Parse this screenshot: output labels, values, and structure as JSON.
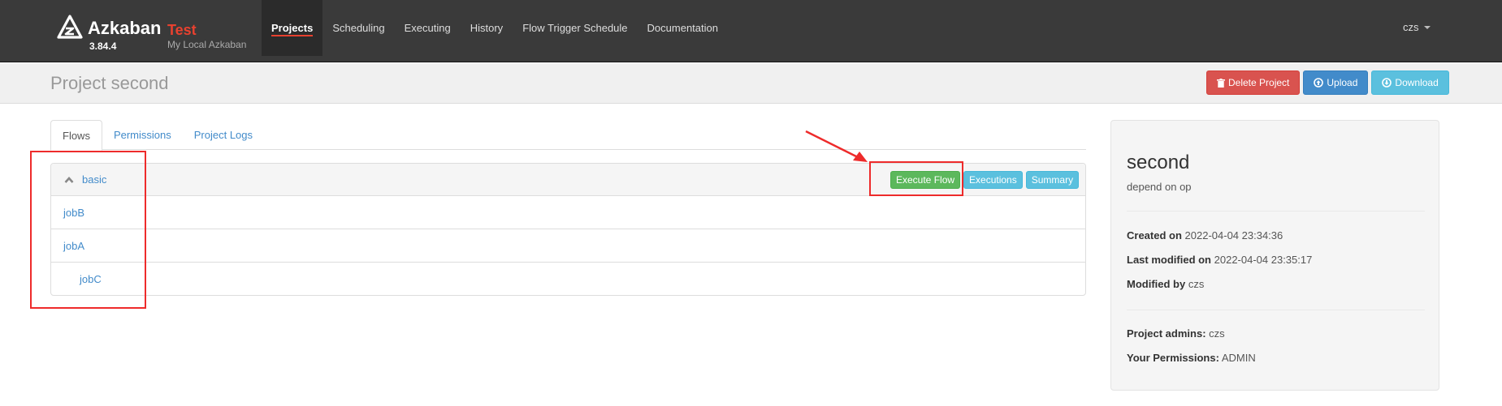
{
  "brand": {
    "name": "Azkaban",
    "env": "Test",
    "version": "3.84.4",
    "subtitle": "My Local Azkaban"
  },
  "nav": {
    "items": [
      {
        "label": "Projects",
        "active": true
      },
      {
        "label": "Scheduling"
      },
      {
        "label": "Executing"
      },
      {
        "label": "History"
      },
      {
        "label": "Flow Trigger Schedule"
      },
      {
        "label": "Documentation"
      }
    ],
    "user": "czs"
  },
  "header": {
    "title": "Project second",
    "buttons": {
      "delete": "Delete Project",
      "upload": "Upload",
      "download": "Download"
    }
  },
  "tabs": [
    {
      "label": "Flows",
      "active": true
    },
    {
      "label": "Permissions"
    },
    {
      "label": "Project Logs"
    }
  ],
  "flow": {
    "name": "basic",
    "actions": {
      "execute": "Execute Flow",
      "executions": "Executions",
      "summary": "Summary"
    },
    "jobs": [
      "jobB",
      "jobA",
      "jobC"
    ]
  },
  "sidebar": {
    "name": "second",
    "description": "depend on op",
    "created_label": "Created on",
    "created": "2022-04-04 23:34:36",
    "modified_label": "Last modified on",
    "modified": "2022-04-04 23:35:17",
    "modified_by_label": "Modified by",
    "modified_by": "czs",
    "admins_label": "Project admins:",
    "admins": "czs",
    "permissions_label": "Your Permissions:",
    "permissions": "ADMIN"
  },
  "colors": {
    "navbar": "#3a3a3a",
    "brand_env": "#e8412f",
    "link": "#428bca",
    "danger": "#d9534f",
    "primary": "#428bca",
    "info": "#5bc0de",
    "success": "#5cb85c",
    "annotation": "#ee2b2b"
  }
}
